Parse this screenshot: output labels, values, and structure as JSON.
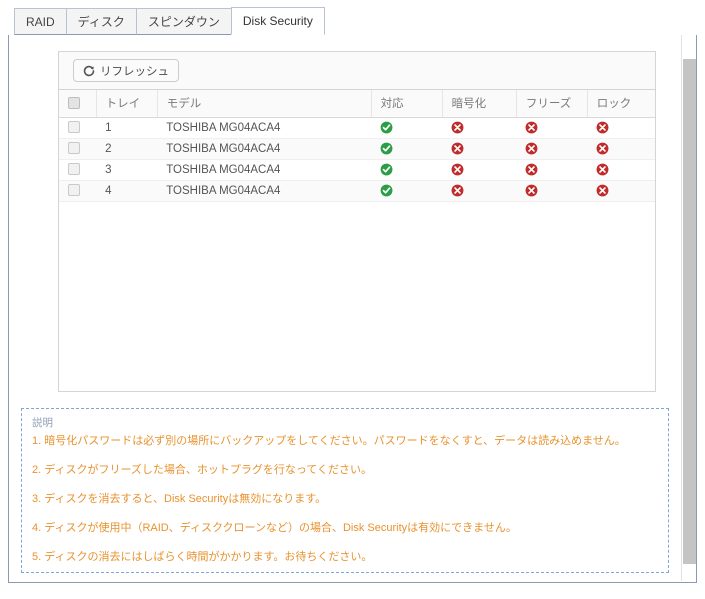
{
  "tabs": [
    {
      "label": "RAID",
      "active": false
    },
    {
      "label": "ディスク",
      "active": false
    },
    {
      "label": "スピンダウン",
      "active": false
    },
    {
      "label": "Disk Security",
      "active": true
    }
  ],
  "toolbar": {
    "refresh_label": "リフレッシュ",
    "refresh_icon": "refresh-icon"
  },
  "table": {
    "headers": {
      "select_all": "",
      "tray": "トレイ",
      "model": "モデル",
      "supported": "対応",
      "encrypted": "暗号化",
      "frozen": "フリーズ",
      "locked": "ロック"
    },
    "rows": [
      {
        "checked": false,
        "tray": "1",
        "model": "TOSHIBA MG04ACA4",
        "supported": "ok",
        "encrypted": "no",
        "frozen": "no",
        "locked": "no"
      },
      {
        "checked": false,
        "tray": "2",
        "model": "TOSHIBA MG04ACA4",
        "supported": "ok",
        "encrypted": "no",
        "frozen": "no",
        "locked": "no"
      },
      {
        "checked": false,
        "tray": "3",
        "model": "TOSHIBA MG04ACA4",
        "supported": "ok",
        "encrypted": "no",
        "frozen": "no",
        "locked": "no"
      },
      {
        "checked": false,
        "tray": "4",
        "model": "TOSHIBA MG04ACA4",
        "supported": "ok",
        "encrypted": "no",
        "frozen": "no",
        "locked": "no"
      }
    ]
  },
  "description": {
    "title": "説明",
    "lines": [
      "1. 暗号化パスワードは必ず別の場所にバックアップをしてください。パスワードをなくすと、データは読み込めません。",
      "2. ディスクがフリーズした場合、ホットプラグを行なってください。",
      "3. ディスクを消去すると、Disk Securityは無効になります。",
      "4. ディスクが使用中（RAID、ディスククローンなど）の場合、Disk Securityは有効にできません。",
      "5. ディスクの消去にはしばらく時間がかかります。お待ちください。"
    ]
  },
  "colors": {
    "status_ok": "#2e9e46",
    "status_no": "#bf2c2c",
    "description_text": "#e8922e",
    "description_border": "#7ea6d8",
    "frame_border": "#8a9ab5"
  },
  "scrollbar": {
    "name": "vertical-scrollbar"
  }
}
